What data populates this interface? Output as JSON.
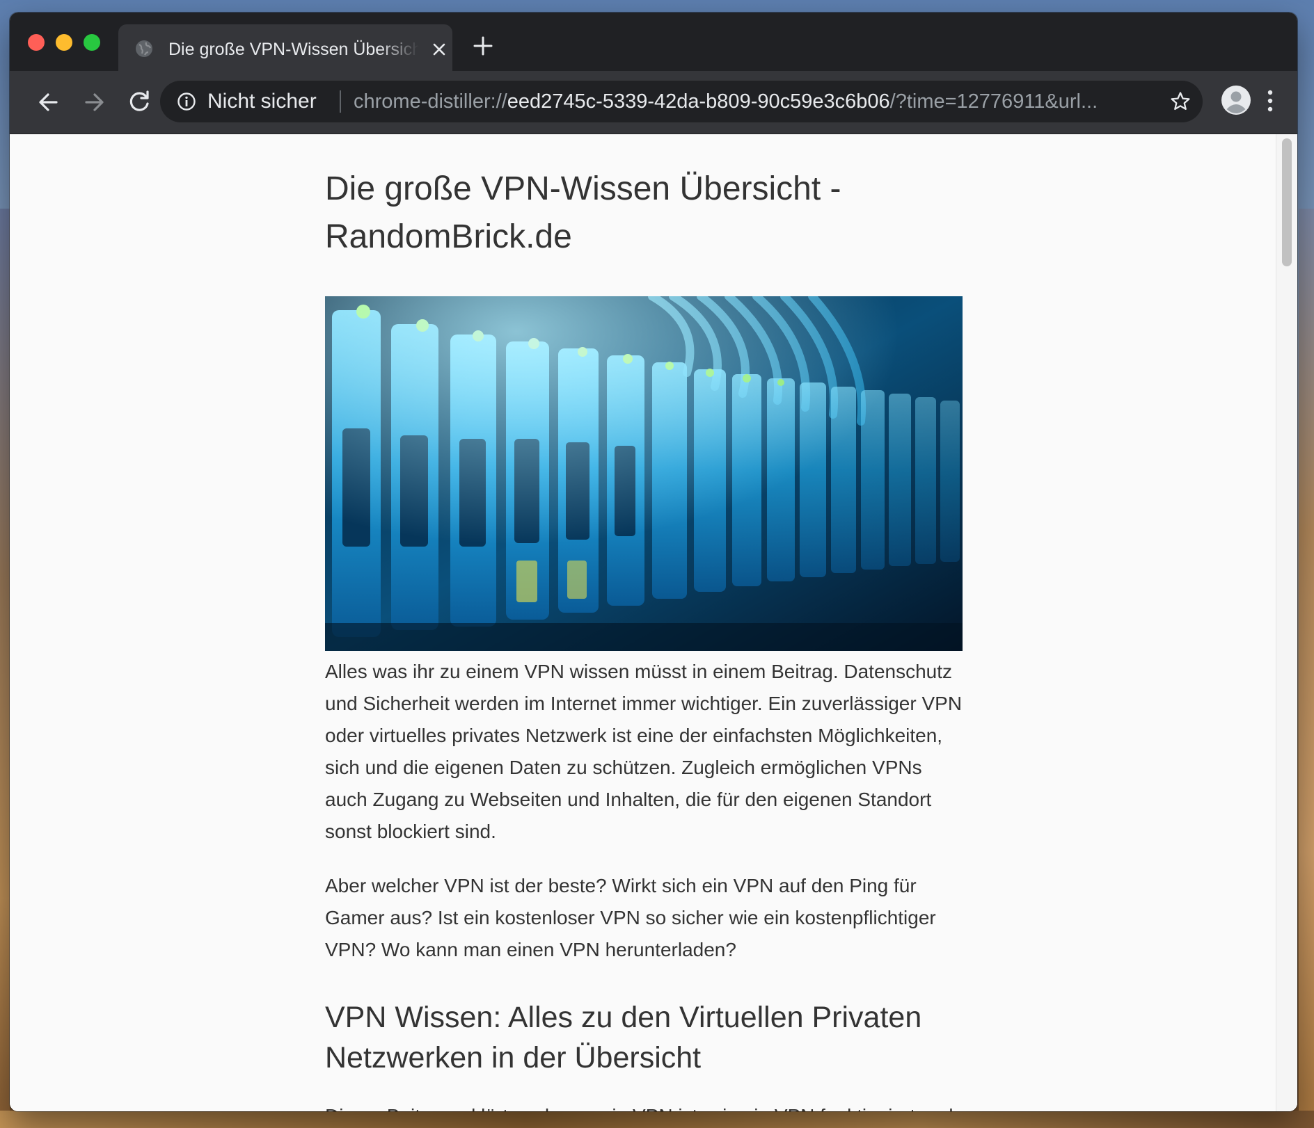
{
  "browser": {
    "tab": {
      "title": "Die große VPN-Wissen Übersicht - RandomBrick.de",
      "favicon": "globe-icon"
    },
    "nav": {
      "back": "arrow-left-icon",
      "forward": "arrow-right-icon",
      "reload": "reload-icon"
    },
    "omnibox": {
      "security_label": "Nicht sicher",
      "url_scheme": "chrome-distiller://",
      "url_host": "eed2745c-5339-42da-b809-90c59e3c6b06",
      "url_rest": "/?time=12776911&url...",
      "bookmark_icon": "star-icon"
    },
    "profile_icon": "avatar-icon",
    "menu_icon": "three-dots-icon"
  },
  "article": {
    "title": "Die große VPN-Wissen Übersicht - RandomBrick.de",
    "hero_alt": "server-rack-image",
    "paragraphs": [
      "Alles was ihr zu einem VPN wissen müsst in einem Beitrag. Datenschutz und Sicherheit werden im Internet immer wichtiger. Ein zuverlässiger VPN oder virtuelles privates Netzwerk ist eine der einfachsten Möglichkeiten, sich und die eigenen Daten zu schützen. Zugleich ermöglichen VPNs auch Zugang zu Webseiten und Inhalten, die für den eigenen Standort sonst blockiert sind.",
      "Aber welcher VPN ist der beste? Wirkt sich ein VPN auf den Ping für Gamer aus? Ist ein kostenloser VPN so sicher wie ein kostenpflichtiger VPN? Wo kann man einen VPN herunterladen?",
      "Dieser Beitrag erklärt euch was ein VPN ist, wie ein VPN funktioniert und"
    ],
    "section_heading": "VPN Wissen: Alles zu den Virtuellen Privaten Netzwerken in der Übersicht"
  },
  "colors": {
    "tabstrip": "#202124",
    "toolbar": "#35363a",
    "page_bg": "#fafafa",
    "text": "#333333"
  }
}
